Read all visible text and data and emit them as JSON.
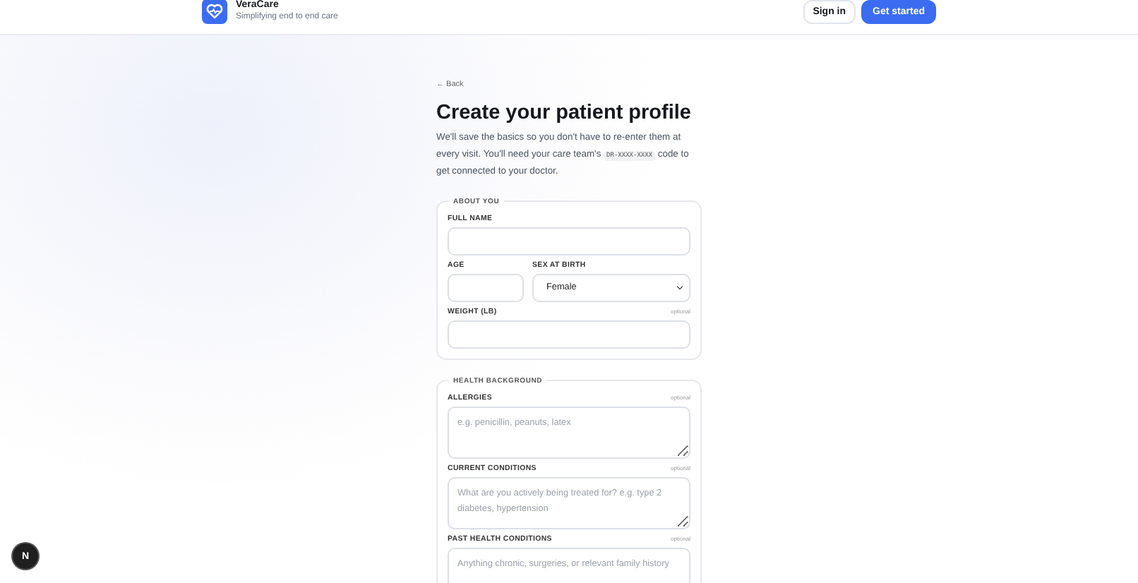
{
  "header": {
    "brand": "VeraCare",
    "tagline": "Simplifying end to end care",
    "buttons": [
      {
        "label": "Sign in",
        "kind": "secondary"
      },
      {
        "label": "Get started",
        "kind": "primary"
      }
    ]
  },
  "back": "← Back",
  "title": "Create your patient profile",
  "intro": {
    "before": "We'll save the basics so you don't have to re-enter them at every visit. You'll need your care team's",
    "code": "DR-XXXX-XXXX",
    "after": "code to get connected to your doctor."
  },
  "sections": [
    {
      "legend": "ABOUT YOU",
      "rows": [
        [
          {
            "kind": "text",
            "label": "FULL NAME"
          }
        ],
        [
          {
            "kind": "text",
            "label": "AGE"
          },
          {
            "kind": "select",
            "label": "SEX AT BIRTH",
            "value": "Female"
          }
        ],
        [
          {
            "kind": "text",
            "label": "WEIGHT (LB)",
            "note": "optional"
          }
        ]
      ]
    },
    {
      "legend": "HEALTH BACKGROUND",
      "rows": [
        [
          {
            "kind": "textarea",
            "label": "ALLERGIES",
            "note": "optional",
            "placeholder": "e.g. penicillin, peanuts, latex"
          }
        ],
        [
          {
            "kind": "textarea",
            "label": "CURRENT CONDITIONS",
            "note": "optional",
            "placeholder": "What are you actively being treated for? e.g. type 2 diabetes, hypertension"
          }
        ],
        [
          {
            "kind": "textarea",
            "label": "PAST HEALTH CONDITIONS",
            "note": "optional",
            "placeholder": "Anything chronic, surgeries, or relevant family history"
          }
        ]
      ]
    }
  ],
  "dev_badge": "N"
}
